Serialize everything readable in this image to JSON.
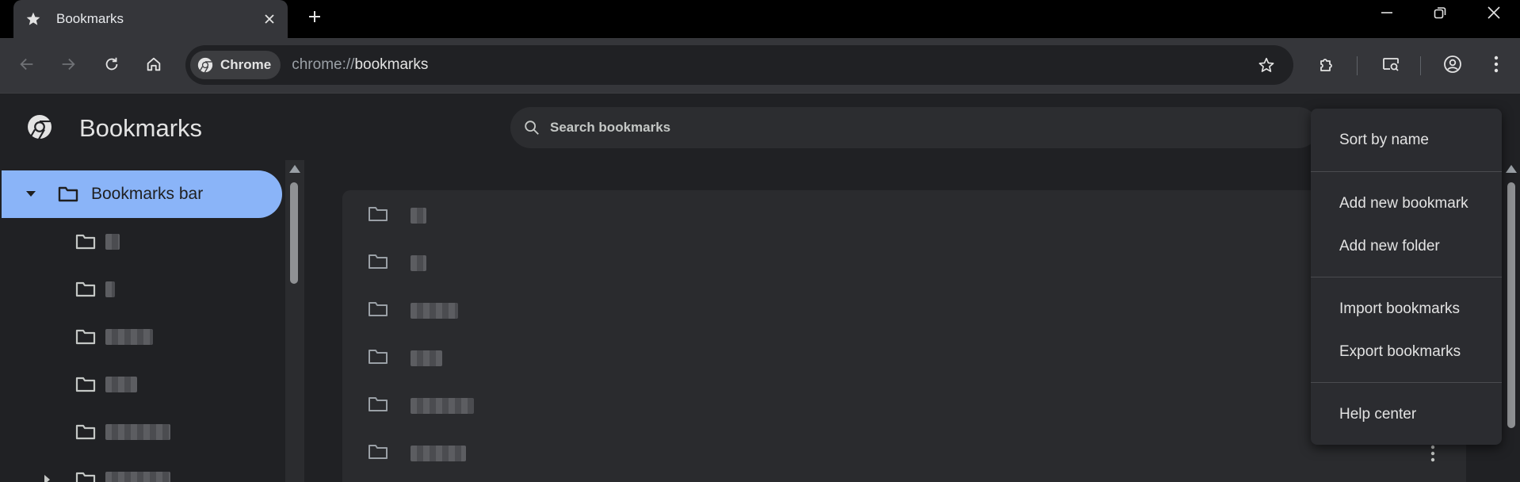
{
  "tab": {
    "title": "Bookmarks"
  },
  "omnibox": {
    "chip_label": "Chrome",
    "url_scheme": "chrome://",
    "url_host": "bookmarks"
  },
  "page": {
    "title": "Bookmarks"
  },
  "search": {
    "placeholder": "Search bookmarks"
  },
  "sidebar": {
    "selected_label": "Bookmarks bar",
    "items": [
      "",
      "",
      "",
      "",
      "",
      ""
    ]
  },
  "dropdown": {
    "items": [
      "Sort by name",
      "Add new bookmark",
      "Add new folder",
      "Import bookmarks",
      "Export bookmarks",
      "Help center"
    ]
  },
  "colors": {
    "accent": "#8ab4f8",
    "background": "#202124",
    "toolbar": "#35363a"
  },
  "icons": [
    "star-icon",
    "close-icon",
    "plus-icon",
    "minimize-icon",
    "restore-icon",
    "back-arrow-icon",
    "forward-arrow-icon",
    "reload-icon",
    "home-icon",
    "chrome-logo-icon",
    "bookmark-star-icon",
    "extensions-icon",
    "tab-search-icon",
    "profile-icon",
    "kebab-menu-icon",
    "search-icon",
    "folder-icon",
    "caret-down-icon",
    "caret-right-icon"
  ]
}
